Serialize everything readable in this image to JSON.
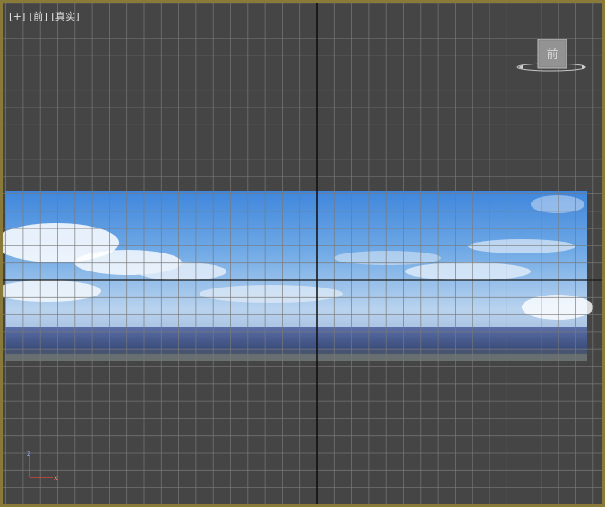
{
  "viewport": {
    "labels": {
      "plus": "[+]",
      "view": "[前]",
      "shading": "[真实]"
    },
    "viewcube": {
      "face_label": "前"
    },
    "axis": {
      "z": "z",
      "x": "x"
    },
    "colors": {
      "background": "#454545",
      "grid_line": "#7a7a7a",
      "axis_line": "#111111",
      "frame_border": "#8a7a3a",
      "sky_top": "#4a8fe0",
      "sky_bottom": "#c9dcef",
      "city_band": "#4a5a8a"
    }
  }
}
